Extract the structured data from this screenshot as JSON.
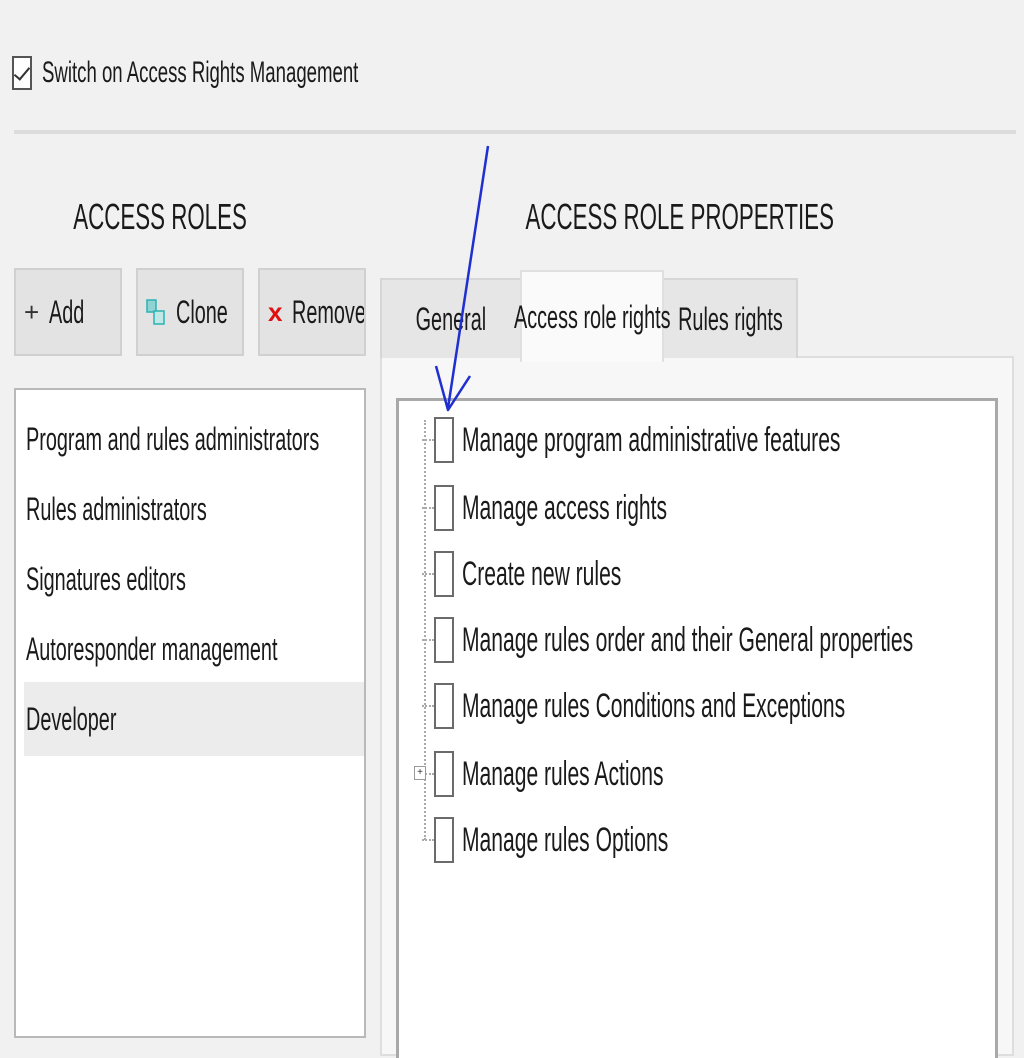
{
  "master_switch": {
    "label": "Switch on Access Rights Management",
    "checked": true
  },
  "roles_panel": {
    "title": "ACCESS ROLES",
    "buttons": {
      "add": "Add",
      "clone": "Clone",
      "remove": "Remove"
    },
    "items": [
      {
        "label": "Program and rules administrators",
        "selected": false
      },
      {
        "label": "Rules administrators",
        "selected": false
      },
      {
        "label": "Signatures editors",
        "selected": false
      },
      {
        "label": "Autoresponder management",
        "selected": false
      },
      {
        "label": "Developer",
        "selected": true
      }
    ]
  },
  "properties_panel": {
    "title": "ACCESS ROLE PROPERTIES",
    "tabs": [
      {
        "label": "General",
        "active": false
      },
      {
        "label": "Access role rights",
        "active": true
      },
      {
        "label": "Rules rights",
        "active": false
      }
    ],
    "rights": [
      {
        "label": "Manage program administrative features",
        "checked": false,
        "expandable": false
      },
      {
        "label": "Manage access rights",
        "checked": false,
        "expandable": false
      },
      {
        "label": "Create new rules",
        "checked": false,
        "expandable": false
      },
      {
        "label": "Manage rules order and their General properties",
        "checked": false,
        "expandable": false
      },
      {
        "label": "Manage rules Conditions and Exceptions",
        "checked": false,
        "expandable": false
      },
      {
        "label": "Manage rules Actions",
        "checked": false,
        "expandable": true
      },
      {
        "label": "Manage rules Options",
        "checked": false,
        "expandable": false
      }
    ]
  },
  "annotation": {
    "type": "arrow",
    "color": "#1f2fd0"
  },
  "colors": {
    "accent_remove": "#dd1111",
    "clone_icon": "#2bb3b1"
  }
}
